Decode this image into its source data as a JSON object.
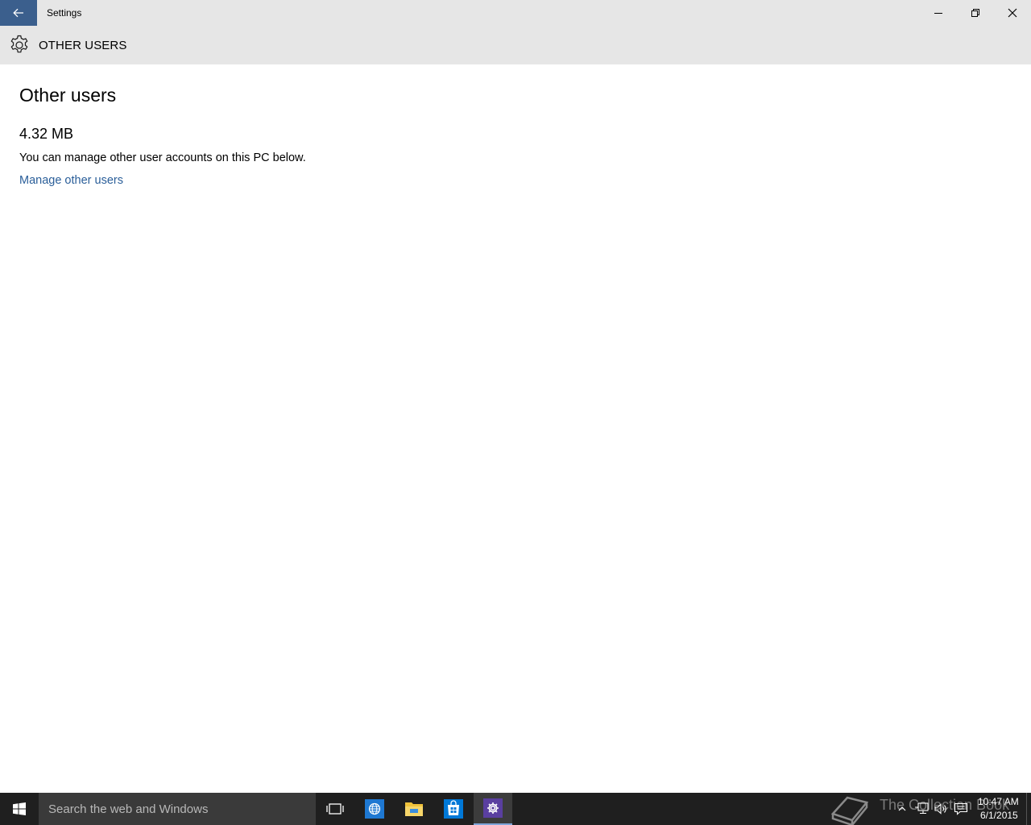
{
  "window": {
    "title": "Settings"
  },
  "header": {
    "title": "OTHER USERS"
  },
  "content": {
    "page_title": "Other users",
    "size": "4.32 MB",
    "description": "You can manage other user accounts on this PC below.",
    "manage_link": "Manage other users"
  },
  "taskbar": {
    "search_placeholder": "Search the web and Windows",
    "watermark": "The Collection Book",
    "time": "10:47 AM",
    "date": "6/1/2015"
  },
  "colors": {
    "titlebar_bg": "#e6e6e6",
    "back_button_bg": "#3b5f8d",
    "link": "#2a5e99",
    "taskbar_bg": "#1f1f1f",
    "search_bg": "#3a3a3a",
    "settings_app_tile": "#5a3fa0",
    "store_tile": "#0078d7"
  },
  "icons": {
    "back": "arrow-left-icon",
    "minimize": "minimize-icon",
    "maximize": "restore-icon",
    "close": "close-icon",
    "header": "gear-icon",
    "start": "windows-logo-icon",
    "task_view": "task-view-icon",
    "edge": "globe-icon",
    "explorer": "folder-icon",
    "store": "store-icon",
    "settings": "gear-icon"
  }
}
